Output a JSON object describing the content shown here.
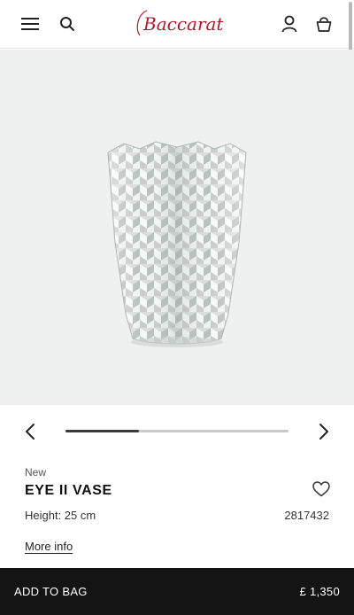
{
  "header": {
    "brand": "Baccarat",
    "brand_color": "#b0182a",
    "icons": [
      "menu-icon",
      "search-icon",
      "account-icon",
      "shopping-bag-icon"
    ]
  },
  "carousel": {
    "progress": 0.33,
    "prev_icon": "chevron-left-icon",
    "next_icon": "chevron-right-icon"
  },
  "product": {
    "badge": "New",
    "name": "EYE II VASE",
    "height": "Height: 25 cm",
    "reference": "2817432",
    "more_info": "More info",
    "wishlist_icon": "heart-icon"
  },
  "cta": {
    "label": "ADD TO BAG",
    "price": "£ 1,350"
  },
  "colors": {
    "image_bg": "#eef1ef",
    "cta_bg": "#141414",
    "progress_fill": "#3a3a3a",
    "progress_track": "#c9c9c9"
  }
}
